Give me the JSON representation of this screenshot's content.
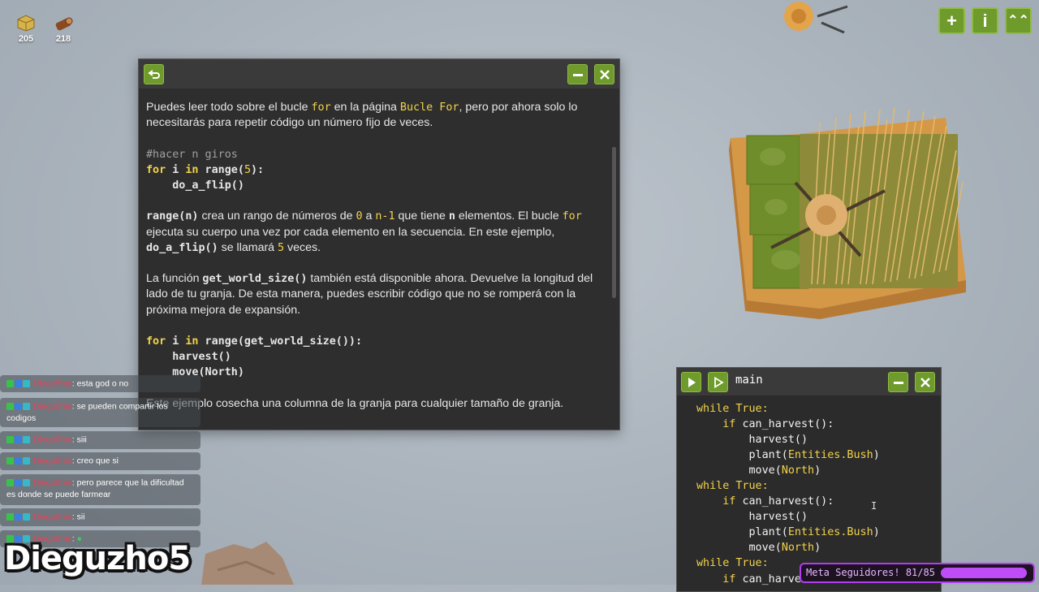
{
  "resources": [
    {
      "icon": "hay-bale-icon",
      "value": "205"
    },
    {
      "icon": "wood-log-icon",
      "value": "218"
    }
  ],
  "top_buttons": [
    {
      "name": "add-button",
      "label": "+"
    },
    {
      "name": "info-button",
      "label": "i"
    },
    {
      "name": "upgrades-button",
      "label": "⌃⌃"
    }
  ],
  "doc": {
    "p1": {
      "a": "Puedes leer todo sobre el bucle ",
      "b": "for",
      "c": " en la página ",
      "d": "Bucle For",
      "e": ", pero por ahora solo lo necesitarás para repetir código un número fijo de veces."
    },
    "code1": {
      "l1": "#hacer n giros",
      "l2_kw": "for",
      "l2_a": " i ",
      "l2_kw2": "in",
      "l2_b": " range(",
      "l2_n": "5",
      "l2_c": "):",
      "l3": "    do_a_flip()"
    },
    "p2": {
      "a": "range(n)",
      "b": " crea un rango de números de ",
      "c": "0",
      "d": " a ",
      "e": "n-1",
      "f": " que tiene ",
      "g": "n",
      "h": " elementos. El bucle ",
      "i": "for",
      "j": " ejecuta su cuerpo una vez por cada elemento en la secuencia. En este ejemplo, ",
      "k": "do_a_flip()",
      "l": " se llamará ",
      "m": "5",
      "n": " veces."
    },
    "p3": {
      "a": "La función ",
      "b": "get_world_size()",
      "c": " también está disponible ahora. Devuelve la longitud del lado de tu granja. De esta manera, puedes escribir código que no se romperá con la próxima mejora de expansión."
    },
    "code2": {
      "l1_kw": "for",
      "l1_a": " i ",
      "l1_kw2": "in",
      "l1_b": " range(get_world_size()):",
      "l2": "    harvest()",
      "l3": "    move(North)"
    },
    "p4": "Este ejemplo cosecha una columna de la granja para cualquier tamaño de granja."
  },
  "editor": {
    "title": "main",
    "lines": [
      {
        "indent": "",
        "parts": [
          {
            "t": "while True:",
            "k": true
          }
        ]
      },
      {
        "indent": "    ",
        "parts": [
          {
            "t": "if ",
            "k": true
          },
          {
            "t": "can_harvest():"
          }
        ]
      },
      {
        "indent": "        ",
        "parts": [
          {
            "t": "harvest()"
          }
        ]
      },
      {
        "indent": "        ",
        "parts": [
          {
            "t": "plant("
          },
          {
            "t": "Entities.Bush",
            "k": true
          },
          {
            "t": ")"
          }
        ]
      },
      {
        "indent": "        ",
        "parts": [
          {
            "t": "move("
          },
          {
            "t": "North",
            "k": true
          },
          {
            "t": ")"
          }
        ]
      },
      {
        "indent": "",
        "parts": [
          {
            "t": "while True:",
            "k": true
          }
        ]
      },
      {
        "indent": "    ",
        "parts": [
          {
            "t": "if ",
            "k": true
          },
          {
            "t": "can_harvest():"
          }
        ]
      },
      {
        "indent": "        ",
        "parts": [
          {
            "t": "harvest()"
          }
        ]
      },
      {
        "indent": "        ",
        "parts": [
          {
            "t": "plant("
          },
          {
            "t": "Entities.Bush",
            "k": true
          },
          {
            "t": ")"
          }
        ]
      },
      {
        "indent": "        ",
        "parts": [
          {
            "t": "move("
          },
          {
            "t": "North",
            "k": true
          },
          {
            "t": ")"
          }
        ]
      },
      {
        "indent": "",
        "parts": [
          {
            "t": "while True:",
            "k": true
          }
        ]
      },
      {
        "indent": "    ",
        "parts": [
          {
            "t": "if ",
            "k": true
          },
          {
            "t": "can_harve"
          }
        ]
      }
    ]
  },
  "chat": [
    {
      "user": "Diegu5fan",
      "msg": "esta god o no"
    },
    {
      "user": "Diegu5fan",
      "msg": "se pueden compartir los codigos"
    },
    {
      "user": "Diegu5fan",
      "msg": "siii"
    },
    {
      "user": "Diegu5fan",
      "msg": "creo que si"
    },
    {
      "user": "Diegu5fan",
      "msg": "pero parece que la dificultad es donde se puede farmear"
    },
    {
      "user": "Diegu5fan",
      "msg": "sii"
    },
    {
      "user": "Diegu5fan",
      "msg": ""
    }
  ],
  "streamer_logo": "Dieguzho5",
  "meta": {
    "label": "Meta Seguidores! 81/85",
    "progress": 0.953
  },
  "colors": {
    "accent_green": "#6f9a2c",
    "keyword_yellow": "#f2d24b",
    "meta_purple": "#c04cf8"
  }
}
